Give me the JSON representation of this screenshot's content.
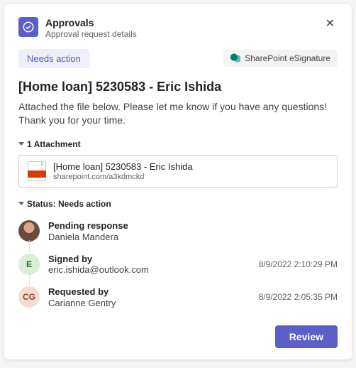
{
  "header": {
    "title": "Approvals",
    "subtitle": "Approval request details"
  },
  "badges": {
    "status": "Needs action",
    "provider": "SharePoint eSignature"
  },
  "request": {
    "title": "[Home loan] 5230583 - Eric Ishida",
    "body": "Attached the file below. Please let me know if you have any questions! Thank you for your time."
  },
  "attachments": {
    "heading": "1 Attachment",
    "items": [
      {
        "name": "[Home loan] 5230583 - Eric Ishida",
        "url": "sharepoint.com/a3kdmckd"
      }
    ]
  },
  "status": {
    "heading": "Status: Needs action",
    "steps": [
      {
        "label": "Pending response",
        "who": "Daniela Mandera",
        "time": "",
        "avatarText": "",
        "avatarClass": "av-photo"
      },
      {
        "label": "Signed by",
        "who": "eric.ishida@outlook.com",
        "time": "8/9/2022 2:10:29 PM",
        "avatarText": "E",
        "avatarClass": "av-e"
      },
      {
        "label": "Requested by",
        "who": "Carianne Gentry",
        "time": "8/9/2022 2:05:35 PM",
        "avatarText": "CG",
        "avatarClass": "av-cg"
      }
    ]
  },
  "actions": {
    "review": "Review"
  }
}
